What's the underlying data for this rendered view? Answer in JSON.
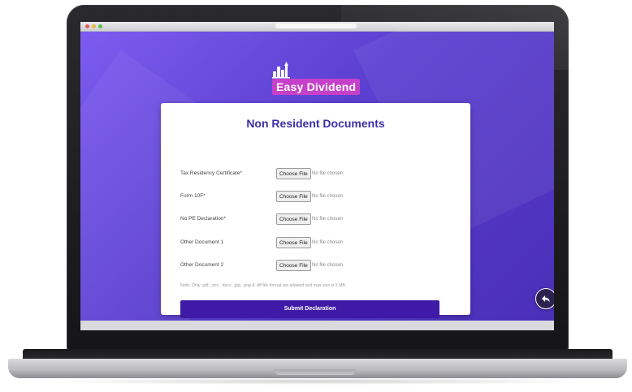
{
  "brand": {
    "name_bold": "Easy Dividend",
    "accent": "#c640c9",
    "icon": "city-skyline-icon"
  },
  "form": {
    "title": "Non Resident Documents",
    "fields": [
      {
        "label": "Tax Residency Certificate*",
        "button": "Choose File",
        "status": "No file chosen"
      },
      {
        "label": "Form 10F*",
        "button": "Choose File",
        "status": "No file chosen"
      },
      {
        "label": "No PE Declaration*",
        "button": "Choose File",
        "status": "No file chosen"
      },
      {
        "label": "Other Document 1",
        "button": "Choose File",
        "status": "No file chosen"
      },
      {
        "label": "Other Document 2",
        "button": "Choose File",
        "status": "No file chosen"
      }
    ],
    "note": "Note: Only .pdf, .doc, .docx, .jpg, .png & .tiff file format are allowed and max size is 5 MB.",
    "submit_label": "Submit Declaration"
  },
  "back_button": {
    "icon": "reply-arrow-icon"
  },
  "colors": {
    "background": "#5b3fd0",
    "title": "#3b2fa8",
    "button": "#3f1aa6"
  }
}
